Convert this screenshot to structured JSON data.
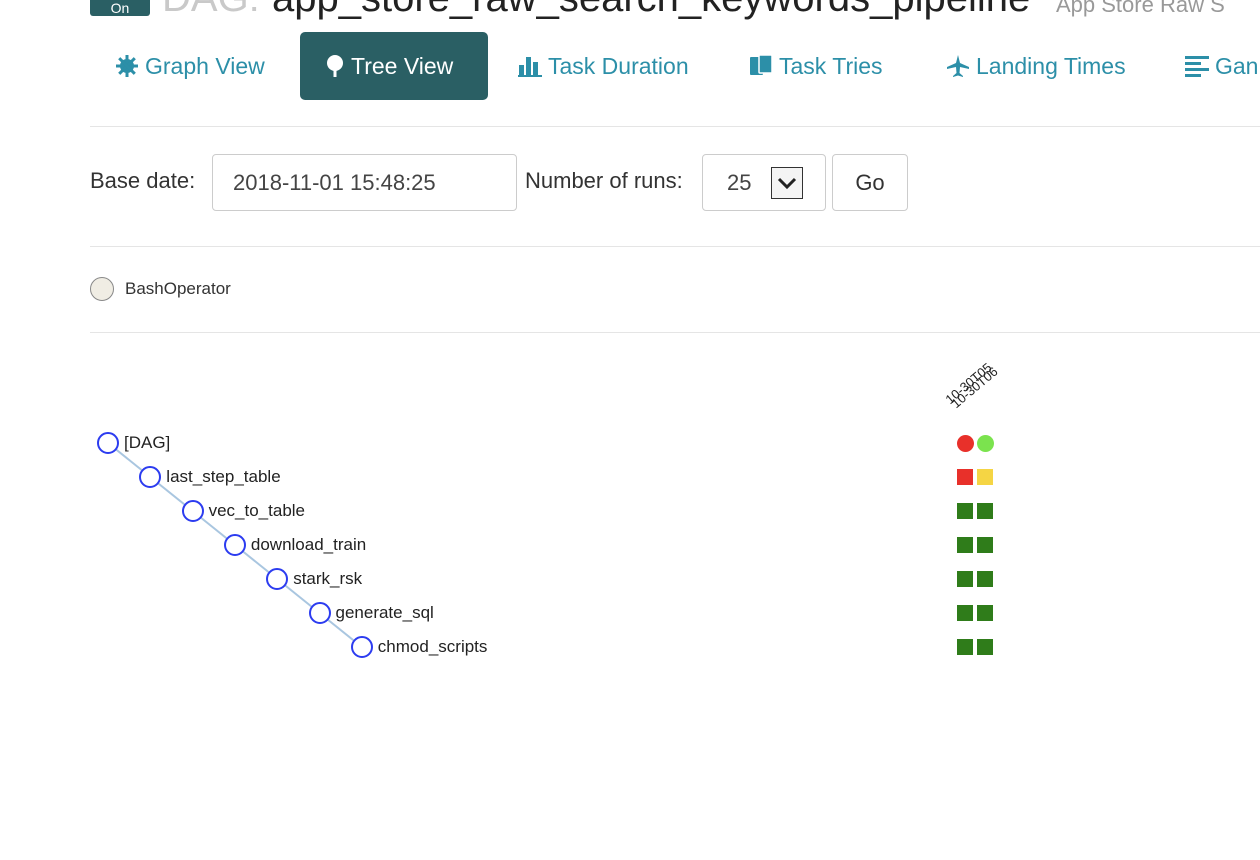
{
  "header": {
    "toggle_label": "On",
    "dag_prefix": "DAG:",
    "dag_id": "app_store_raw_search_keywords_pipeline",
    "description": "App Store Raw S"
  },
  "tabs": [
    {
      "label": "Graph View",
      "icon": "gear-icon"
    },
    {
      "label": "Tree View",
      "icon": "tree-icon",
      "active": true
    },
    {
      "label": "Task Duration",
      "icon": "bar-chart-icon"
    },
    {
      "label": "Task Tries",
      "icon": "copy-icon"
    },
    {
      "label": "Landing Times",
      "icon": "plane-icon"
    },
    {
      "label": "Gan",
      "icon": "align-left-icon"
    }
  ],
  "form": {
    "base_date_label": "Base date:",
    "base_date_value": "2018-11-01 15:48:25",
    "runs_label": "Number of runs:",
    "runs_value": "25",
    "go_label": "Go"
  },
  "legend": {
    "operator": "BashOperator",
    "color": "#f0ede4"
  },
  "run_headers": [
    "10-30T05",
    "10-30T06"
  ],
  "tree": [
    {
      "name": "[DAG]",
      "states": [
        "failed",
        "running"
      ]
    },
    {
      "name": "last_step_table",
      "states": [
        "failed",
        "up_for_retry"
      ]
    },
    {
      "name": "vec_to_table",
      "states": [
        "success",
        "success"
      ]
    },
    {
      "name": "download_train",
      "states": [
        "success",
        "success"
      ]
    },
    {
      "name": "stark_rsk",
      "states": [
        "success",
        "success"
      ]
    },
    {
      "name": "generate_sql",
      "states": [
        "success",
        "success"
      ]
    },
    {
      "name": "chmod_scripts",
      "states": [
        "success",
        "success"
      ]
    }
  ],
  "state_colors": {
    "failed": "#e8302a",
    "running": "#7be34e",
    "up_for_retry": "#f5d544",
    "success": "#2f7c1a"
  },
  "node_color": "#2c3cf0",
  "link_color": "#a9c6e0"
}
